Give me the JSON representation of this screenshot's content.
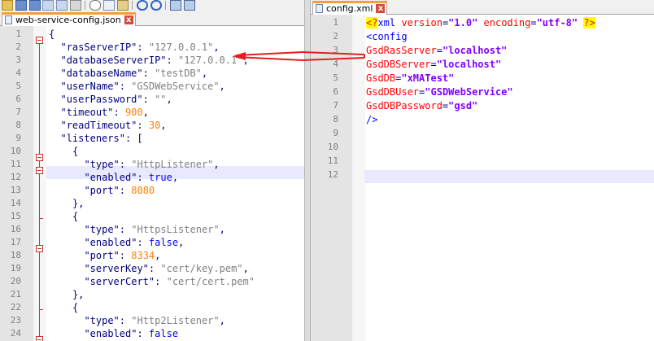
{
  "left": {
    "tab": {
      "label": "web-service-config.json",
      "close_label": "x"
    },
    "lines": [
      {
        "n": "1",
        "seg": [
          [
            "op",
            "{"
          ]
        ]
      },
      {
        "n": "2",
        "seg": [
          [
            "k",
            "\"rasServerIP\""
          ],
          [
            "op",
            ": "
          ],
          [
            "s",
            "\"127.0.0.1\""
          ],
          [
            "op",
            ","
          ]
        ]
      },
      {
        "n": "3",
        "seg": [
          [
            "k",
            "\"databaseServerIP\""
          ],
          [
            "op",
            ": "
          ],
          [
            "s",
            "\"127.0.0.1\""
          ],
          [
            "op",
            ","
          ]
        ]
      },
      {
        "n": "4",
        "seg": [
          [
            "k",
            "\"databaseName\""
          ],
          [
            "op",
            ": "
          ],
          [
            "s",
            "\"testDB\""
          ],
          [
            "op",
            ","
          ]
        ]
      },
      {
        "n": "5",
        "seg": [
          [
            "k",
            "\"userName\""
          ],
          [
            "op",
            ": "
          ],
          [
            "s",
            "\"GSDWebService\""
          ],
          [
            "op",
            ","
          ]
        ]
      },
      {
        "n": "6",
        "seg": [
          [
            "k",
            "\"userPassword\""
          ],
          [
            "op",
            ": "
          ],
          [
            "s",
            "\"\""
          ],
          [
            "op",
            ","
          ]
        ]
      },
      {
        "n": "7",
        "seg": [
          [
            "k",
            "\"timeout\""
          ],
          [
            "op",
            ": "
          ],
          [
            "n",
            "900"
          ],
          [
            "op",
            ","
          ]
        ]
      },
      {
        "n": "8",
        "seg": [
          [
            "k",
            "\"readTimeout\""
          ],
          [
            "op",
            ": "
          ],
          [
            "n",
            "30"
          ],
          [
            "op",
            ","
          ]
        ]
      },
      {
        "n": "9",
        "seg": [
          [
            "k",
            "\"listeners\""
          ],
          [
            "op",
            ": ["
          ]
        ]
      },
      {
        "n": "10",
        "seg": [
          [
            "op",
            "{"
          ]
        ]
      },
      {
        "n": "11",
        "seg": [
          [
            "k",
            "\"type\""
          ],
          [
            "op",
            ": "
          ],
          [
            "s",
            "\"HttpListener\""
          ],
          [
            "op",
            ","
          ]
        ]
      },
      {
        "n": "12",
        "seg": [
          [
            "k",
            "\"enabled\""
          ],
          [
            "op",
            ": "
          ],
          [
            "kw",
            "true"
          ],
          [
            "op",
            ","
          ]
        ]
      },
      {
        "n": "13",
        "seg": [
          [
            "k",
            "\"port\""
          ],
          [
            "op",
            ": "
          ],
          [
            "n",
            "8080"
          ]
        ]
      },
      {
        "n": "14",
        "seg": [
          [
            "op",
            "},"
          ]
        ]
      },
      {
        "n": "15",
        "seg": [
          [
            "op",
            "{"
          ]
        ]
      },
      {
        "n": "16",
        "seg": [
          [
            "k",
            "\"type\""
          ],
          [
            "op",
            ": "
          ],
          [
            "s",
            "\"HttpsListener\""
          ],
          [
            "op",
            ","
          ]
        ]
      },
      {
        "n": "17",
        "seg": [
          [
            "k",
            "\"enabled\""
          ],
          [
            "op",
            ": "
          ],
          [
            "kw",
            "false"
          ],
          [
            "op",
            ","
          ]
        ]
      },
      {
        "n": "18",
        "seg": [
          [
            "k",
            "\"port\""
          ],
          [
            "op",
            ": "
          ],
          [
            "n",
            "8334"
          ],
          [
            "op",
            ","
          ]
        ]
      },
      {
        "n": "19",
        "seg": [
          [
            "k",
            "\"serverKey\""
          ],
          [
            "op",
            ": "
          ],
          [
            "s",
            "\"cert/key.pem\""
          ],
          [
            "op",
            ","
          ]
        ]
      },
      {
        "n": "20",
        "seg": [
          [
            "k",
            "\"serverCert\""
          ],
          [
            "op",
            ": "
          ],
          [
            "s",
            "\"cert/cert.pem\""
          ]
        ]
      },
      {
        "n": "21",
        "seg": [
          [
            "op",
            "},"
          ]
        ]
      },
      {
        "n": "22",
        "seg": [
          [
            "op",
            "{"
          ]
        ]
      },
      {
        "n": "23",
        "seg": [
          [
            "k",
            "\"type\""
          ],
          [
            "op",
            ": "
          ],
          [
            "s",
            "\"Http2Listener\""
          ],
          [
            "op",
            ","
          ]
        ]
      },
      {
        "n": "24",
        "seg": [
          [
            "k",
            "\"enabled\""
          ],
          [
            "op",
            ": "
          ],
          [
            "kw",
            "false"
          ]
        ]
      }
    ]
  },
  "right": {
    "tab": {
      "label": "config.xml",
      "close_label": "x"
    },
    "lines": [
      {
        "n": "1",
        "seg": [
          [
            "pi",
            "<?"
          ],
          [
            "xt",
            "xml "
          ],
          [
            "xa",
            "version"
          ],
          [
            "op",
            "="
          ],
          [
            "xv",
            "\"1.0\""
          ],
          [
            "xt",
            " "
          ],
          [
            "xa",
            "encoding"
          ],
          [
            "op",
            "="
          ],
          [
            "xv",
            "\"utf-8\""
          ],
          [
            "xt",
            " "
          ],
          [
            "pi",
            "?>"
          ]
        ]
      },
      {
        "n": "2",
        "seg": [
          [
            "xt",
            "<config"
          ]
        ]
      },
      {
        "n": "3",
        "seg": [
          [
            "xa",
            "GsdRasServer"
          ],
          [
            "op",
            "="
          ],
          [
            "xv",
            "\"localhost\""
          ]
        ]
      },
      {
        "n": "4",
        "seg": [
          [
            "xa",
            "GsdDBServer"
          ],
          [
            "op",
            "="
          ],
          [
            "xv",
            "\"localhost\""
          ]
        ]
      },
      {
        "n": "5",
        "seg": [
          [
            "xa",
            "GsdDB"
          ],
          [
            "op",
            "="
          ],
          [
            "xv",
            "\"xMATest\""
          ]
        ]
      },
      {
        "n": "6",
        "seg": [
          [
            "xa",
            "GsdDBUser"
          ],
          [
            "op",
            "="
          ],
          [
            "xv",
            "\"GSDWebService\""
          ]
        ]
      },
      {
        "n": "7",
        "seg": [
          [
            "xa",
            "GsdDBPassword"
          ],
          [
            "op",
            "="
          ],
          [
            "xv",
            "\"gsd\""
          ]
        ]
      },
      {
        "n": "8",
        "seg": [
          [
            "xt",
            "/>"
          ]
        ]
      },
      {
        "n": "9",
        "seg": []
      },
      {
        "n": "10",
        "seg": []
      },
      {
        "n": "11",
        "seg": []
      },
      {
        "n": "12",
        "seg": []
      }
    ]
  },
  "colors": {
    "annotation_arrow": "#e02020",
    "current_line": "#e8e8ff",
    "tab_accent": "#f89c3c"
  }
}
